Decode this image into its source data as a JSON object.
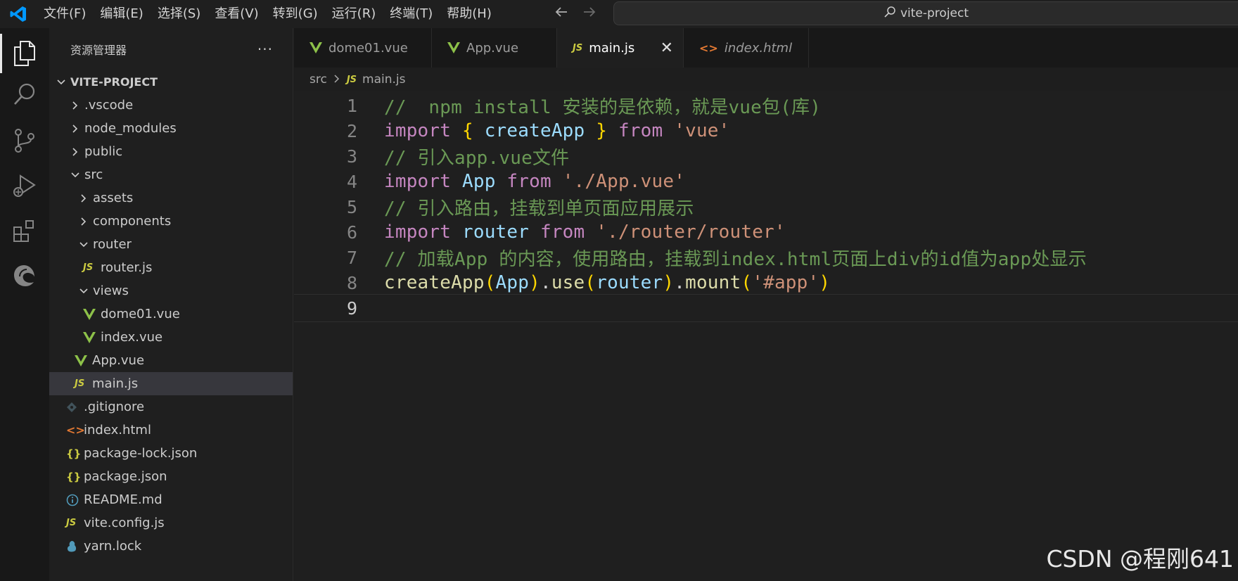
{
  "titlebar": {
    "menu": [
      "文件(F)",
      "编辑(E)",
      "选择(S)",
      "查看(V)",
      "转到(G)",
      "运行(R)",
      "终端(T)",
      "帮助(H)"
    ],
    "search_label": "vite-project",
    "accent": "#0098ff"
  },
  "activity_bar": {
    "items": [
      "explorer-icon",
      "search-icon",
      "source-control-icon",
      "run-debug-icon",
      "extensions-icon",
      "edge-icon"
    ]
  },
  "sidebar": {
    "title": "资源管理器",
    "more": "···",
    "root": "VITE-PROJECT",
    "items": [
      {
        "label": ".vscode",
        "type": "folder",
        "state": "collapsed"
      },
      {
        "label": "node_modules",
        "type": "folder",
        "state": "collapsed"
      },
      {
        "label": "public",
        "type": "folder",
        "state": "collapsed"
      },
      {
        "label": "src",
        "type": "folder",
        "state": "expanded"
      },
      {
        "label": "assets",
        "type": "folder",
        "state": "collapsed"
      },
      {
        "label": "components",
        "type": "folder",
        "state": "collapsed"
      },
      {
        "label": "router",
        "type": "folder",
        "state": "expanded"
      },
      {
        "label": "router.js",
        "type": "js"
      },
      {
        "label": "views",
        "type": "folder",
        "state": "expanded"
      },
      {
        "label": "dome01.vue",
        "type": "vue"
      },
      {
        "label": "index.vue",
        "type": "vue"
      },
      {
        "label": "App.vue",
        "type": "vue"
      },
      {
        "label": "main.js",
        "type": "js",
        "selected": true
      },
      {
        "label": ".gitignore",
        "type": "git"
      },
      {
        "label": "index.html",
        "type": "html"
      },
      {
        "label": "package-lock.json",
        "type": "json"
      },
      {
        "label": "package.json",
        "type": "json"
      },
      {
        "label": "README.md",
        "type": "info"
      },
      {
        "label": "vite.config.js",
        "type": "js"
      },
      {
        "label": "yarn.lock",
        "type": "yarn"
      }
    ]
  },
  "tabs": [
    {
      "label": "dome01.vue",
      "type": "vue"
    },
    {
      "label": "App.vue",
      "type": "vue"
    },
    {
      "label": "main.js",
      "type": "js",
      "active": true,
      "close": "✕"
    },
    {
      "label": "index.html",
      "type": "html",
      "italic": true
    }
  ],
  "breadcrumb": {
    "folder": "src",
    "file": "main.js",
    "icon_text": "JS"
  },
  "editor": {
    "line_numbers": [
      "1",
      "2",
      "3",
      "4",
      "5",
      "6",
      "7",
      "8",
      "9"
    ],
    "current_line": 9
  },
  "watermark": "CSDN @程刚641"
}
